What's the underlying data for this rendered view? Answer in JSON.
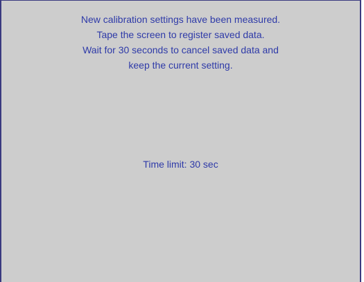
{
  "dialog": {
    "message_lines": [
      "New calibration settings have been measured.",
      "Tape the screen to register saved data.",
      "Wait for 30 seconds to cancel saved data and",
      "keep the current setting."
    ],
    "time_limit": "Time limit: 30 sec"
  },
  "colors": {
    "background": "#cdcdcd",
    "text": "#2e3aa8",
    "border": "#3a3a80"
  }
}
